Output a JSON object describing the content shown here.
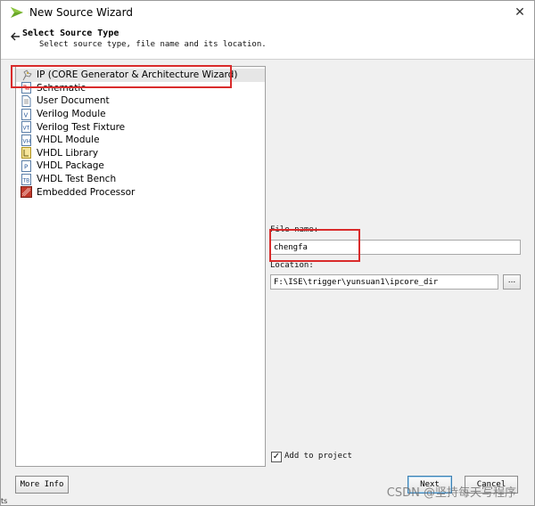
{
  "window": {
    "title": "New Source Wizard",
    "close_glyph": "✕"
  },
  "header": {
    "title": "Select Source Type",
    "subtitle": "Select source type, file name and its location."
  },
  "source_types": [
    {
      "label": "IP (CORE Generator & Architecture Wizard)",
      "icon": "ip-core-icon"
    },
    {
      "label": "Schematic",
      "icon": "schematic-icon"
    },
    {
      "label": "User Document",
      "icon": "document-icon"
    },
    {
      "label": "Verilog Module",
      "icon": "verilog-module-icon"
    },
    {
      "label": "Verilog Test Fixture",
      "icon": "verilog-test-fixture-icon"
    },
    {
      "label": "VHDL Module",
      "icon": "vhdl-module-icon"
    },
    {
      "label": "VHDL Library",
      "icon": "vhdl-library-icon"
    },
    {
      "label": "VHDL Package",
      "icon": "vhdl-package-icon"
    },
    {
      "label": "VHDL Test Bench",
      "icon": "vhdl-test-bench-icon"
    },
    {
      "label": "Embedded Processor",
      "icon": "embedded-processor-icon"
    }
  ],
  "form": {
    "file_name_label": "File name:",
    "file_name_value": "chengfa",
    "location_label": "Location:",
    "location_value": "F:\\ISE\\trigger\\yunsuan1\\ipcore_dir",
    "browse_label": "...",
    "add_to_project_label": "Add to project",
    "add_to_project_checked": true
  },
  "buttons": {
    "more_info": "More Info",
    "next": "Next",
    "cancel": "Cancel"
  },
  "watermark": "CSDN @坚持每天写程序",
  "edge_label": "ts",
  "colors": {
    "highlight": "#d92b2b",
    "selected_row": "#e6e6e6",
    "window_bg": "#f0f0f0"
  }
}
